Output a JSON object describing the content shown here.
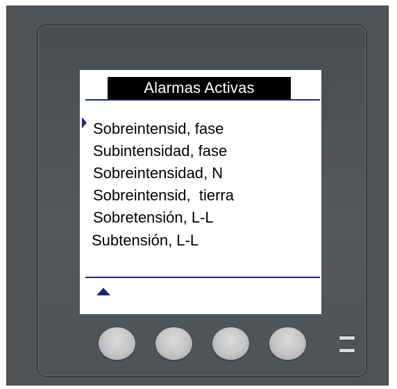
{
  "screen": {
    "title": "Alarmas Activas",
    "alarms": [
      "Sobreintensid, fase",
      "Subintensidad, fase",
      "Sobreintensidad, N",
      "Sobreintensid,  tierra",
      "Sobretensión, L-L",
      "Subtensión, L-L"
    ],
    "selected_index": 0,
    "cursor_icon": "triangle-right",
    "scroll_icon": "triangle-up"
  },
  "device": {
    "soft_keys": [
      "",
      "",
      "",
      ""
    ],
    "indicators": 2
  },
  "colors": {
    "frame": "#505356",
    "screen_background": "#ffffff",
    "title_background": "#000000",
    "title_text": "#ffffff",
    "accent": "#1a2a6e",
    "button": "#c2c4c6"
  }
}
